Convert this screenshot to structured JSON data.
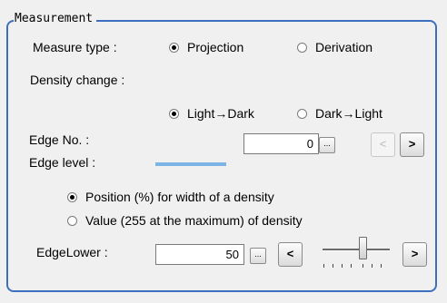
{
  "group_title": "Measurement",
  "measure_type": {
    "label": "Measure type :",
    "options": [
      "Projection",
      "Derivation"
    ],
    "selected": "Projection"
  },
  "density_change": {
    "label": "Density change :",
    "options": [
      "Light→Dark",
      "Dark→Light"
    ],
    "selected": "Light→Dark"
  },
  "edge_no": {
    "label": "Edge No. :",
    "value": "0",
    "browse_label": "...",
    "prev_label": "<",
    "next_label": ">"
  },
  "edge_level": {
    "label": "Edge level :",
    "options": [
      "Position (%) for width of a density",
      "Value (255 at the maximum) of density"
    ],
    "selected": "Position (%) for width of a density"
  },
  "edge_lower": {
    "label": "EdgeLower :",
    "value": "50",
    "browse_label": "...",
    "dec_label": "<",
    "inc_label": ">",
    "slider_level": 0.6
  },
  "colors": {
    "frame": "#3d6fc0",
    "edge_bar": "#7cb4e6",
    "background": "#f0f0f0"
  }
}
